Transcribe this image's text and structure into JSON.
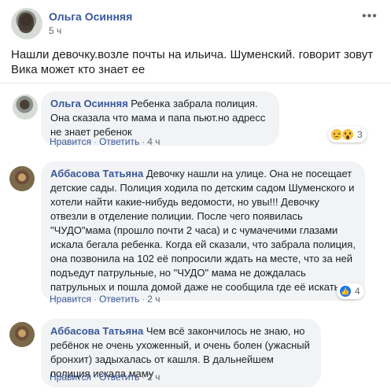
{
  "post": {
    "author": "Ольга Осинняя",
    "time": "5 ч",
    "menu_icon": "more-dots-icon",
    "text": "Нашли девочку.возле почты на ильича. Шуменский. говорит зовут Вика может кто знает ее"
  },
  "comments": [
    {
      "author": "Ольга Осинняя",
      "text": "Ребенка забрала полиция. Она сказала что мама и папа пьют.но адресс не знает ребенок",
      "like_label": "Нравится",
      "reply_label": "Ответить",
      "time": "4 ч",
      "reactions": {
        "icons": [
          "sad-emoji-icon",
          "wow-emoji-icon"
        ],
        "count": "3"
      }
    },
    {
      "author": "Аббасова Татьяна",
      "text": "Девочку нашли на улице. Она не посещает детские сады. Полиция ходила по детским садом Шуменского и хотели найти какие-нибудь ведомости, но увы!!! Девочку отвезли в отделение полиции. После чего появилась \"ЧУДО\"мама (прошло почти 2 часа) и с чумачечими глазами искала бегала ребенка. Когда ей сказали, что забрала полиция, она позвонила на 102 её попросили ждать на месте, что за ней подъедут патрульные, но \"ЧУДО\" мама не дождалась патрульных и пошла домой даже не сообщила где её искать.",
      "like_label": "Нравится",
      "reply_label": "Ответить",
      "time": "2 ч",
      "reactions": {
        "icons": [
          "like-icon"
        ],
        "count": "4"
      }
    },
    {
      "author": "Аббасова Татьяна",
      "text": "Чем всё закончилось не знаю, но ребёнок не очень ухоженный, и очень болен (ужасный бронхит) задыхалась от кашля. В дальнейшем полиция искала маму",
      "like_label": "Нравится",
      "reply_label": "Ответить",
      "time": "2 ч"
    }
  ],
  "colors": {
    "name_link": "#385898",
    "bubble_bg": "#f2f3f5",
    "meta_gray": "#606770",
    "like_blue": "#1877f2"
  }
}
